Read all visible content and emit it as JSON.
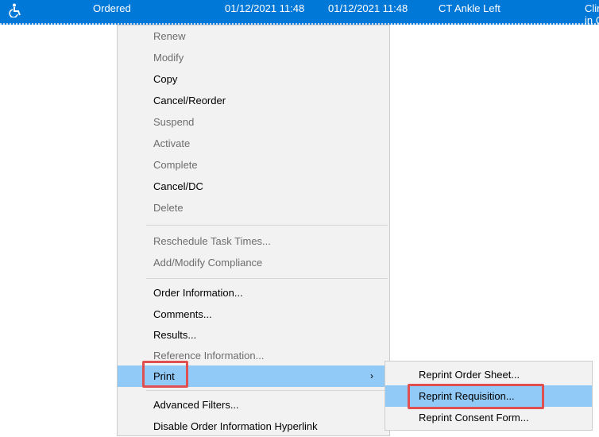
{
  "order_row": {
    "icon": "wheelchair-accessibility-icon",
    "status": "Ordered",
    "start_time": "01/12/2021 11:48",
    "stop_time": "01/12/2021 11:48",
    "procedure": "CT Ankle Left",
    "extra_line1": "Clir",
    "extra_line2": "in C"
  },
  "context_menu": {
    "items": [
      {
        "label": "Renew",
        "enabled": false
      },
      {
        "label": "Modify",
        "enabled": false
      },
      {
        "label": "Copy",
        "enabled": true
      },
      {
        "label": "Cancel/Reorder",
        "enabled": true
      },
      {
        "label": "Suspend",
        "enabled": false
      },
      {
        "label": "Activate",
        "enabled": false
      },
      {
        "label": "Complete",
        "enabled": false
      },
      {
        "label": "Cancel/DC",
        "enabled": true
      },
      {
        "label": "Delete",
        "enabled": false
      },
      {
        "label": "Reschedule Task Times...",
        "enabled": false
      },
      {
        "label": "Add/Modify Compliance",
        "enabled": false
      },
      {
        "label": "Order Information...",
        "enabled": true
      },
      {
        "label": "Comments...",
        "enabled": true
      },
      {
        "label": "Results...",
        "enabled": true
      },
      {
        "label": "Reference Information...",
        "enabled": false
      },
      {
        "label": "Print",
        "enabled": true,
        "highlighted": true,
        "submenu_arrow": "›"
      },
      {
        "label": "Advanced Filters...",
        "enabled": true
      },
      {
        "label": "Disable Order Information Hyperlink",
        "enabled": true
      }
    ]
  },
  "print_submenu": {
    "items": [
      {
        "label": "Reprint Order Sheet...",
        "enabled": true
      },
      {
        "label": "Reprint Requisition...",
        "enabled": true,
        "highlighted": true
      },
      {
        "label": "Reprint Consent Form...",
        "enabled": true
      }
    ]
  },
  "colors": {
    "row_selection": "#0078d7",
    "menu_background": "#f2f2f2",
    "menu_highlight": "#91c9f7",
    "disabled_text": "#6d6d6d",
    "annotation_box": "#e15050"
  }
}
